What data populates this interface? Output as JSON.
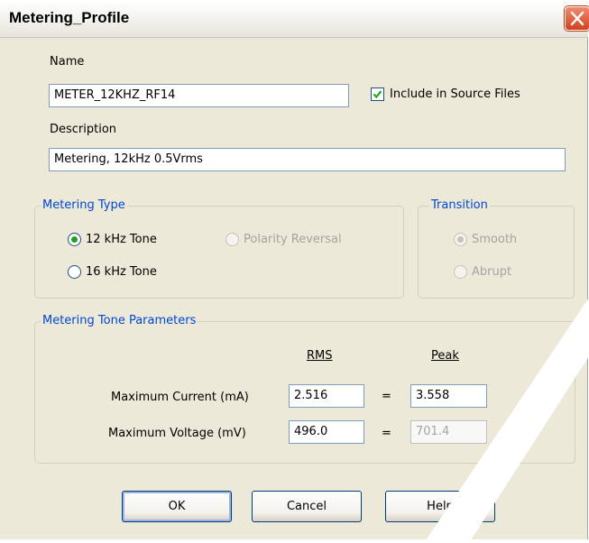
{
  "window": {
    "title": "Metering_Profile"
  },
  "name": {
    "label": "Name",
    "value": "METER_12KHZ_RF14"
  },
  "include_source": {
    "label": "Include in Source Files",
    "checked": true
  },
  "description": {
    "label": "Description",
    "value": "Metering, 12kHz 0.5Vrms"
  },
  "metering_type": {
    "legend": "Metering Type",
    "options": [
      {
        "label": "12 kHz Tone",
        "selected": true,
        "enabled": true
      },
      {
        "label": "Polarity Reversal",
        "selected": false,
        "enabled": false
      },
      {
        "label": "16 kHz Tone",
        "selected": false,
        "enabled": true
      }
    ]
  },
  "transition": {
    "legend": "Transition",
    "options": [
      {
        "label": "Smooth",
        "selected": true,
        "enabled": false
      },
      {
        "label": "Abrupt",
        "selected": false,
        "enabled": false
      }
    ]
  },
  "tone_params": {
    "legend": "Metering Tone Parameters",
    "col_rms": "RMS",
    "col_peak": "Peak",
    "rows": [
      {
        "label": "Maximum Current (mA)",
        "rms": "2.516",
        "equals": "=",
        "peak": "3.558",
        "peak_enabled": true
      },
      {
        "label": "Maximum Voltage (mV)",
        "rms": "496.0",
        "equals": "=",
        "peak": "701.4",
        "peak_enabled": false
      }
    ]
  },
  "buttons": {
    "ok": "OK",
    "cancel": "Cancel",
    "help": "Help"
  },
  "colors": {
    "legend_text": "#0046d5",
    "check_mark": "#21a121",
    "radio_dot": "#21a121"
  }
}
